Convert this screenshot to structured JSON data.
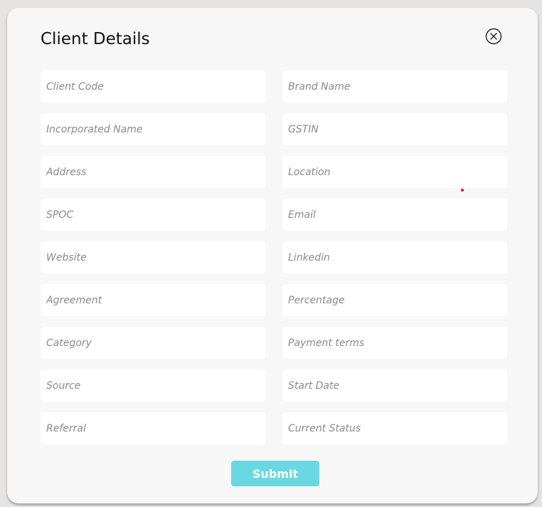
{
  "dialog": {
    "title": "Client Details",
    "close_icon": "close-circle-icon"
  },
  "fields": [
    {
      "placeholder": "Client Code",
      "value": ""
    },
    {
      "placeholder": "Brand Name",
      "value": ""
    },
    {
      "placeholder": "Incorporated Name",
      "value": ""
    },
    {
      "placeholder": "GSTIN",
      "value": ""
    },
    {
      "placeholder": "Address",
      "value": ""
    },
    {
      "placeholder": "Location",
      "value": ""
    },
    {
      "placeholder": "SPOC",
      "value": ""
    },
    {
      "placeholder": "Email",
      "value": ""
    },
    {
      "placeholder": "Website",
      "value": ""
    },
    {
      "placeholder": "Linkedin",
      "value": ""
    },
    {
      "placeholder": "Agreement",
      "value": ""
    },
    {
      "placeholder": "Percentage",
      "value": ""
    },
    {
      "placeholder": "Category",
      "value": ""
    },
    {
      "placeholder": "Payment terms",
      "value": ""
    },
    {
      "placeholder": "Source",
      "value": ""
    },
    {
      "placeholder": "Start Date",
      "value": ""
    },
    {
      "placeholder": "Referral",
      "value": ""
    },
    {
      "placeholder": "Current Status",
      "value": ""
    }
  ],
  "actions": {
    "submit_label": "Submit"
  },
  "colors": {
    "background": "#e6e4e2",
    "modal": "#f7f7f7",
    "field": "#ffffff",
    "submit": "#6ad8e2",
    "cursor_dot": "#e01010"
  }
}
